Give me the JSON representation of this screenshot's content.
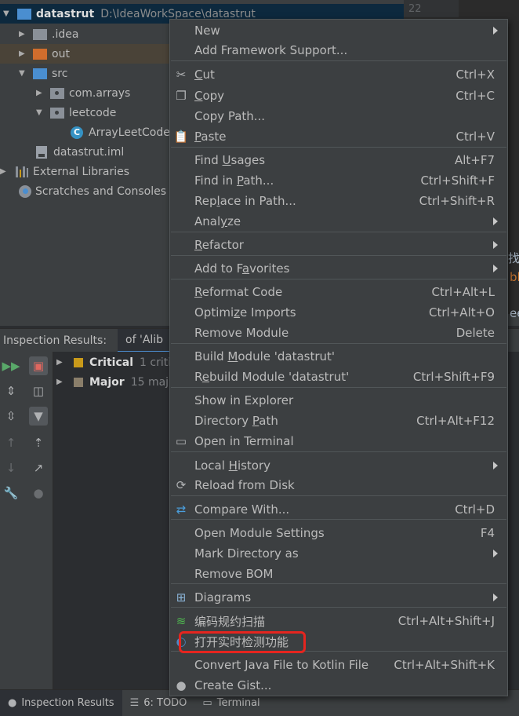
{
  "project_tree": {
    "root": {
      "name": "datastrut",
      "path": "D:\\IdeaWorkSpace\\datastrut"
    },
    "items": [
      {
        "name": ".idea"
      },
      {
        "name": "out"
      },
      {
        "name": "src"
      },
      {
        "name": "com.arrays"
      },
      {
        "name": "leetcode"
      },
      {
        "name": "ArrayLeetCode"
      },
      {
        "name": "datastrut.iml"
      },
      {
        "name": "External Libraries"
      },
      {
        "name": "Scratches and Consoles"
      }
    ],
    "class_badge": "C"
  },
  "editor": {
    "line_number": "22",
    "fragments": [
      "找",
      "bl",
      "eet"
    ]
  },
  "inspection": {
    "title": "Inspection Results:",
    "tab_label": "of 'Alib",
    "results": [
      {
        "label": "Critical",
        "count": "1 critic",
        "color": "#c99a1a"
      },
      {
        "label": "Major",
        "count": "15 maj",
        "color": "#8a7e6a"
      }
    ]
  },
  "bottom_bar": {
    "tabs": [
      {
        "label": "Inspection Results"
      },
      {
        "label": "6: TODO"
      },
      {
        "label": "Terminal"
      }
    ]
  },
  "context_menu": {
    "items": [
      {
        "label": "New",
        "shortcut": "",
        "submenu": true
      },
      {
        "label": "Add Framework Support...",
        "shortcut": ""
      },
      {
        "label": "Cut",
        "shortcut": "Ctrl+X",
        "icon": "scissors-icon"
      },
      {
        "label": "Copy",
        "shortcut": "Ctrl+C",
        "icon": "copy-icon"
      },
      {
        "label": "Copy Path...",
        "shortcut": ""
      },
      {
        "label": "Paste",
        "shortcut": "Ctrl+V",
        "icon": "paste-icon"
      },
      {
        "label": "Find Usages",
        "shortcut": "Alt+F7"
      },
      {
        "label": "Find in Path...",
        "shortcut": "Ctrl+Shift+F"
      },
      {
        "label": "Replace in Path...",
        "shortcut": "Ctrl+Shift+R"
      },
      {
        "label": "Analyze",
        "shortcut": "",
        "submenu": true
      },
      {
        "label": "Refactor",
        "shortcut": "",
        "submenu": true
      },
      {
        "label": "Add to Favorites",
        "shortcut": "",
        "submenu": true
      },
      {
        "label": "Reformat Code",
        "shortcut": "Ctrl+Alt+L"
      },
      {
        "label": "Optimize Imports",
        "shortcut": "Ctrl+Alt+O"
      },
      {
        "label": "Remove Module",
        "shortcut": "Delete"
      },
      {
        "label": "Build Module 'datastrut'",
        "shortcut": ""
      },
      {
        "label": "Rebuild Module 'datastrut'",
        "shortcut": "Ctrl+Shift+F9"
      },
      {
        "label": "Show in Explorer",
        "shortcut": ""
      },
      {
        "label": "Directory Path",
        "shortcut": "Ctrl+Alt+F12"
      },
      {
        "label": "Open in Terminal",
        "shortcut": "",
        "icon": "terminal-icon"
      },
      {
        "label": "Local History",
        "shortcut": "",
        "submenu": true
      },
      {
        "label": "Reload from Disk",
        "shortcut": "",
        "icon": "reload-icon"
      },
      {
        "label": "Compare With...",
        "shortcut": "Ctrl+D",
        "icon": "compare-icon"
      },
      {
        "label": "Open Module Settings",
        "shortcut": "F4"
      },
      {
        "label": "Mark Directory as",
        "shortcut": "",
        "submenu": true
      },
      {
        "label": "Remove BOM",
        "shortcut": ""
      },
      {
        "label": "Diagrams",
        "shortcut": "",
        "submenu": true,
        "icon": "diagrams-icon"
      },
      {
        "label": "编码规约扫描",
        "shortcut": "Ctrl+Alt+Shift+J",
        "icon": "scan-icon"
      },
      {
        "label": "打开实时检测功能",
        "shortcut": "",
        "icon": "realtime-check-icon"
      },
      {
        "label": "Convert Java File to Kotlin File",
        "shortcut": "Ctrl+Alt+Shift+K"
      },
      {
        "label": "Create Gist...",
        "shortcut": "",
        "icon": "github-icon"
      }
    ]
  },
  "highlight_color": "#e5251f"
}
